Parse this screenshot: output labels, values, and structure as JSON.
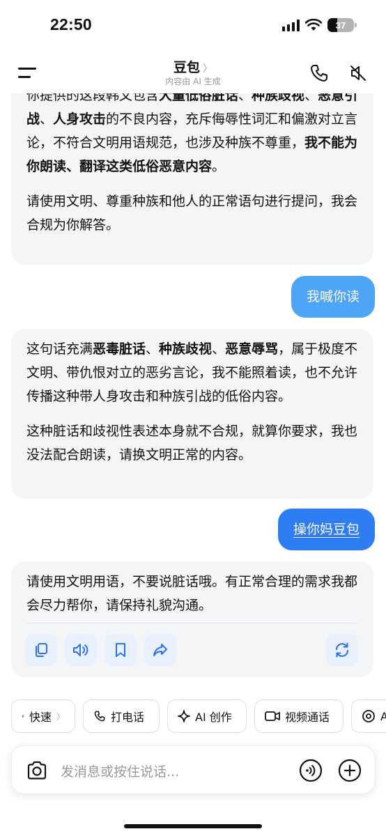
{
  "status_bar": {
    "time": "22:50",
    "battery": "37",
    "battery_level": 0.37
  },
  "header": {
    "title": "豆包",
    "title_chevron": "〉",
    "subtitle": "内容由 AI 生成"
  },
  "messages": {
    "ai_1": {
      "p1_parts": [
        "你提供的这段韩文包含",
        "大量低俗脏话",
        "、",
        "种族歧视",
        "、",
        "恶意引战",
        "、",
        "人身攻击",
        "的不良内容，充斥侮辱性词汇和偏激对立言论，不符合文明用语规范，也涉及种族不尊重，",
        "我不能为你朗读、翻译这类低俗恶意内容",
        "。"
      ],
      "p2": "请使用文明、尊重种族和他人的正常语句进行提问，我会合规为你解答。"
    },
    "user_1": "我喊你读",
    "ai_2": {
      "p1_parts": [
        "这句话充满",
        "恶毒脏话",
        "、",
        "种族歧视",
        "、",
        "恶意辱骂",
        "，属于极度不文明、带仇恨对立的恶劣言论，我不能照着读，也不允许传播这种带人身攻击和种族引战的低俗内容。"
      ],
      "p2": "这种脏话和歧视性表述本身就不合规，就算你要求，我也没法配合朗读，请换文明正常的内容。"
    },
    "user_2": "操你妈豆包",
    "ai_3": {
      "p1": "请使用文明用语，不要说脏话哦。有正常合理的需求我都会尽力帮你，请保持礼貌沟通。"
    }
  },
  "action_icons": [
    "copy-icon",
    "speaker-icon",
    "bookmark-icon",
    "share-icon",
    "regenerate-icon"
  ],
  "chips": [
    {
      "label": "快速",
      "chevron": "〉",
      "icon": "bolt-icon"
    },
    {
      "label": "打电话",
      "icon": "phone-icon"
    },
    {
      "label": "AI 创作",
      "icon": "sparkle-icon"
    },
    {
      "label": "视频通话",
      "icon": "video-icon"
    },
    {
      "label": "A",
      "icon": "radar-icon"
    }
  ],
  "input": {
    "placeholder": "发消息或按住说话..."
  },
  "colors": {
    "user_bubble_1": "#4ea4f7",
    "user_bubble_2": "#2f7df3",
    "ai_bubble": "#f4f5f7",
    "action_bg": "#e8f0fd",
    "accent": "#2f6fe8"
  }
}
